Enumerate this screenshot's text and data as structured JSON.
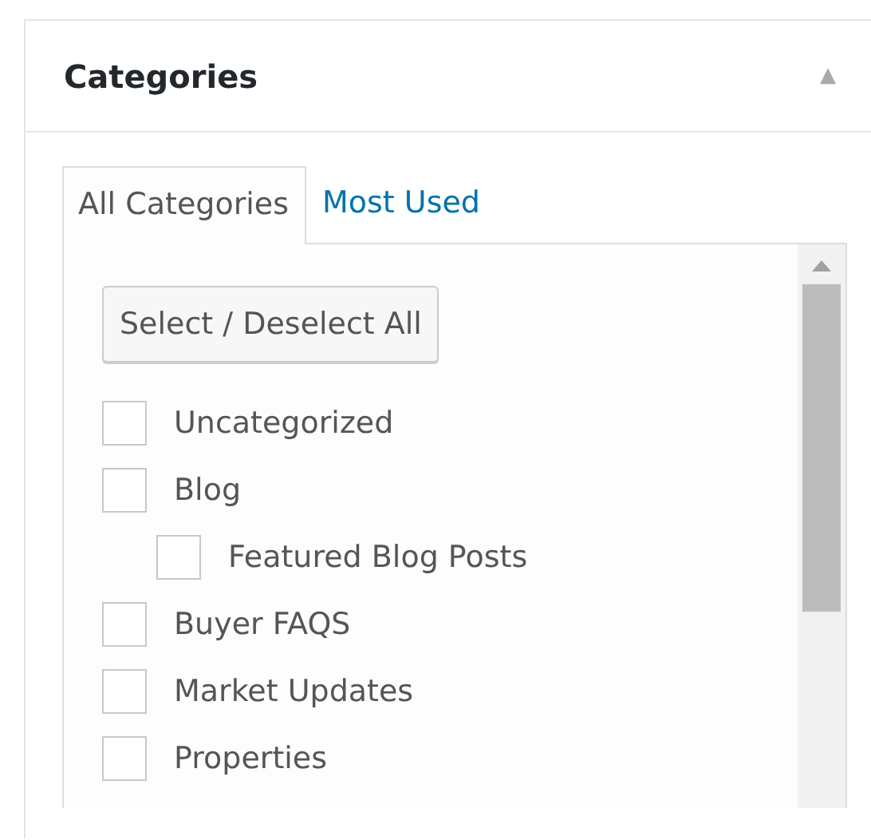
{
  "panel": {
    "title": "Categories",
    "collapse_glyph": "▲"
  },
  "tabs": [
    {
      "label": "All Categories",
      "selected": true
    },
    {
      "label": "Most Used",
      "selected": false
    }
  ],
  "select_all_button": "Select / Deselect All",
  "categories": [
    {
      "label": "Uncategorized",
      "checked": false
    },
    {
      "label": "Blog",
      "checked": false,
      "children": [
        {
          "label": "Featured Blog Posts",
          "checked": false
        }
      ]
    },
    {
      "label": "Buyer FAQS",
      "checked": false
    },
    {
      "label": "Market Updates",
      "checked": false
    },
    {
      "label": "Properties",
      "checked": false
    }
  ]
}
